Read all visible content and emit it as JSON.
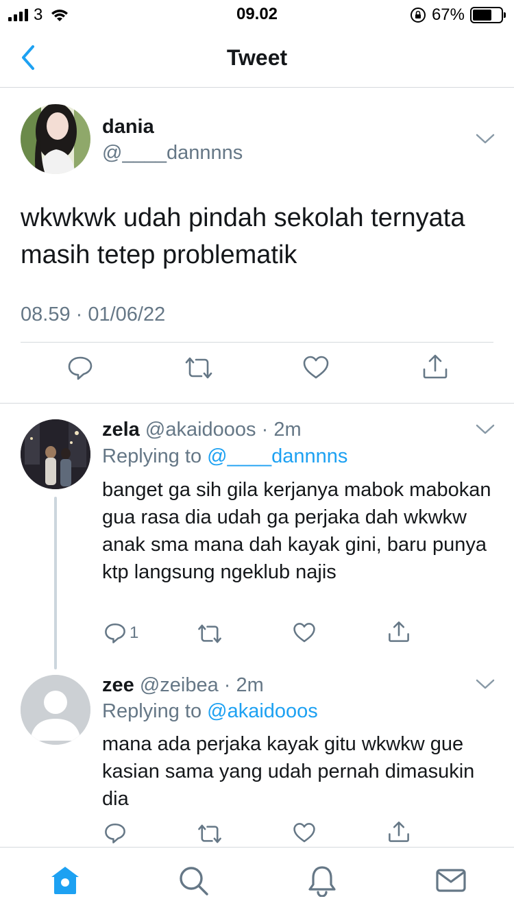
{
  "status_bar": {
    "carrier": "3",
    "time": "09.02",
    "battery_percent": "67%",
    "battery_level": 0.67,
    "icons": [
      "signal-icon",
      "wifi-icon",
      "orientation-lock-icon",
      "battery-icon"
    ]
  },
  "header": {
    "title": "Tweet",
    "back_icon": "chevron-left-icon"
  },
  "main_tweet": {
    "name": "dania",
    "handle": "@____dannnns",
    "text": "wkwkwk udah pindah sekolah ternyata masih tetep problematik",
    "timestamp": "08.59 · 01/06/22",
    "actions": [
      "reply-icon",
      "retweet-icon",
      "like-icon",
      "share-icon"
    ]
  },
  "replies": [
    {
      "name": "zela",
      "handle": "@akaidooos",
      "time": "· 2m",
      "replying_prefix": "Replying to",
      "replying_to": "@____dannnns",
      "text": "banget ga sih gila kerjanya mabok mabokan gua rasa dia udah ga perjaka dah wkwkw anak sma mana dah kayak gini, baru punya ktp langsung ngeklub najis",
      "reply_count": "1"
    },
    {
      "name": "zee",
      "handle": "@zeibea",
      "time": "· 2m",
      "replying_prefix": "Replying to",
      "replying_to": "@akaidooos",
      "text": "mana ada perjaka kayak gitu wkwkw gue kasian sama yang udah pernah dimasukin dia",
      "reply_count": ""
    }
  ],
  "tabbar": {
    "items": [
      "home-icon",
      "search-icon",
      "notifications-icon",
      "messages-icon"
    ],
    "active_color": "#1da1f2"
  },
  "colors": {
    "accent": "#1da1f2",
    "secondary_text": "#657786",
    "primary_text": "#14171a",
    "divider": "#d5d9dd"
  }
}
